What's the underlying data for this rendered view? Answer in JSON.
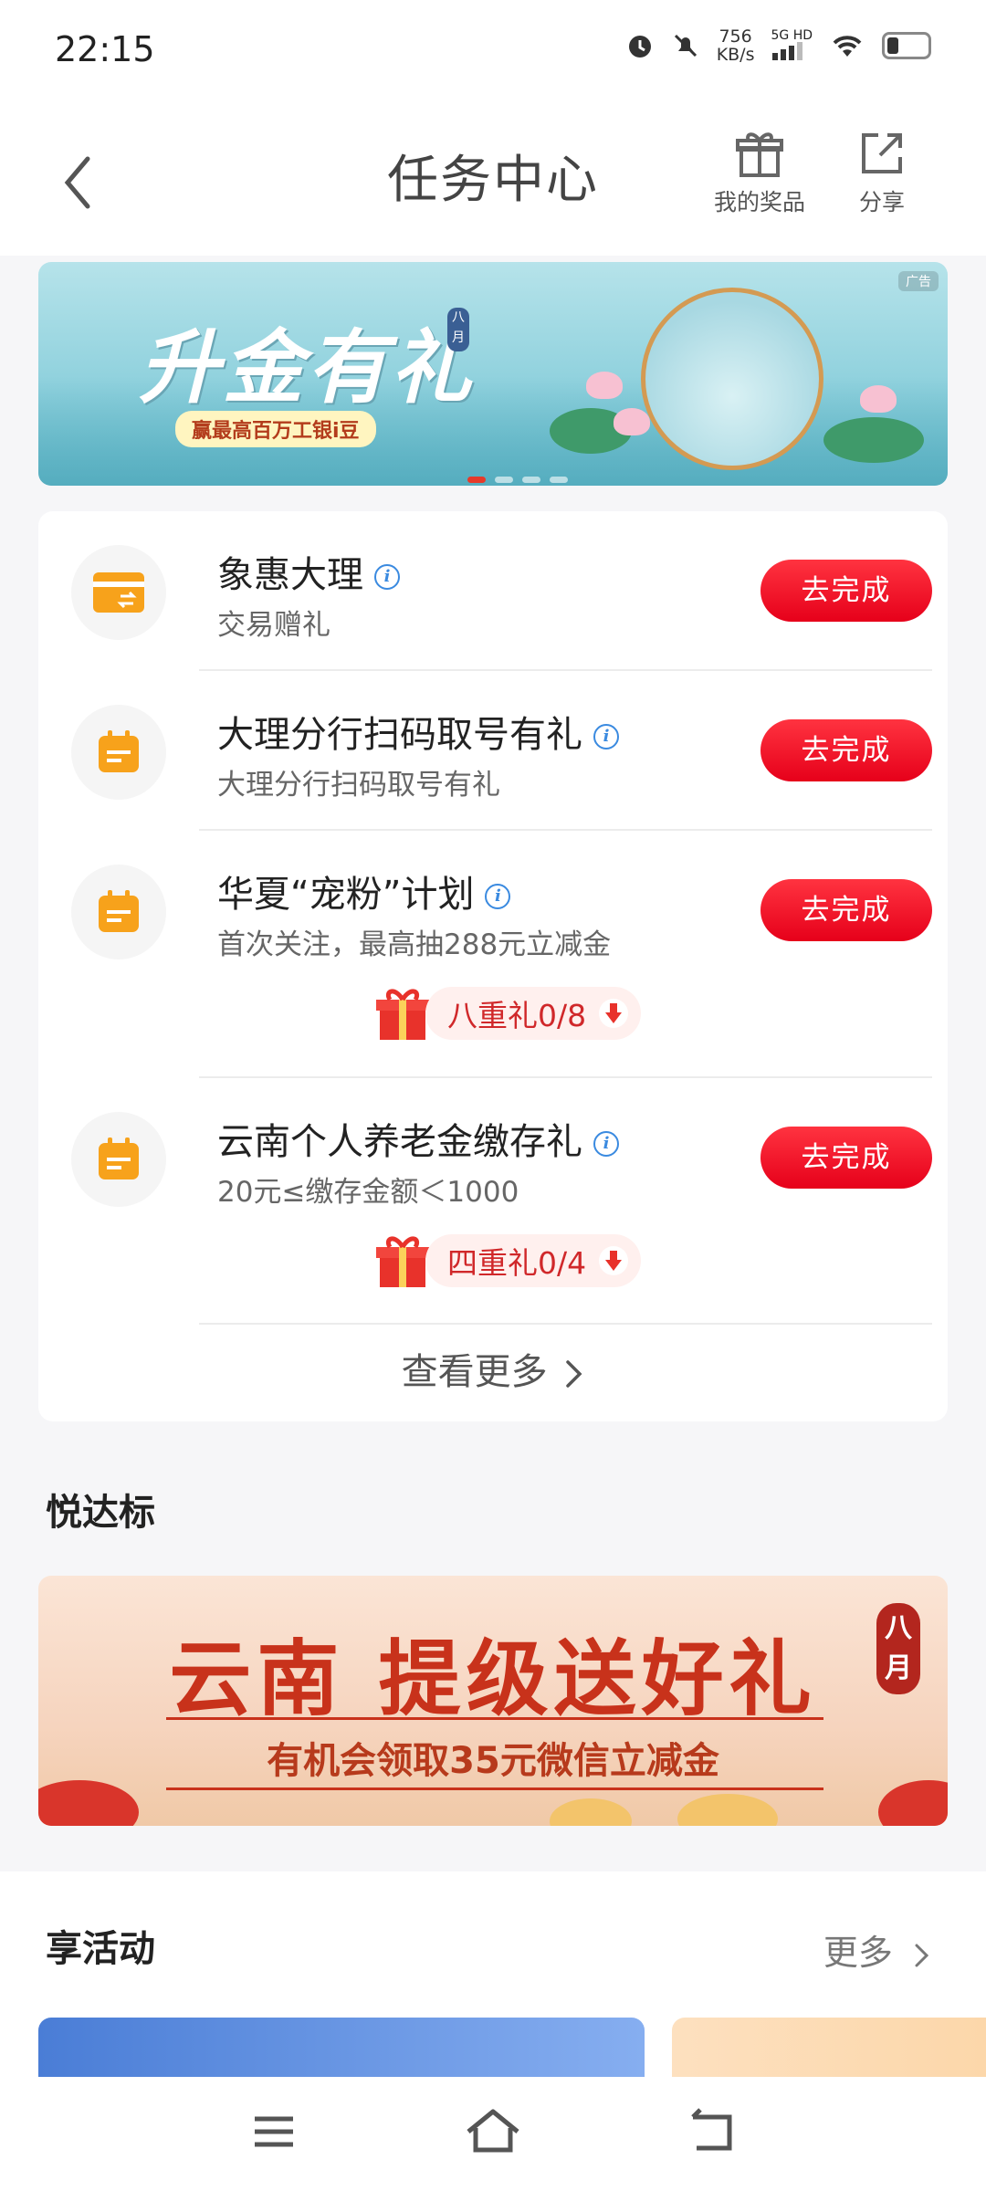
{
  "status_bar": {
    "time": "22:15",
    "net_speed_value": "756",
    "net_speed_unit": "KB/s",
    "signal_label": "5G HD"
  },
  "header": {
    "title": "任务中心",
    "prizes_label": "我的奖品",
    "share_label": "分享"
  },
  "top_banner": {
    "title": "升金有礼",
    "subtitle": "赢最高百万工银i豆",
    "tag": "八月",
    "ad_label": "广告",
    "page_count": 4,
    "active_page": 1
  },
  "tasks": [
    {
      "name": "象惠大理",
      "desc": "交易赠礼",
      "button": "去完成",
      "icon": "card-transfer-icon"
    },
    {
      "name": "大理分行扫码取号有礼",
      "desc": "大理分行扫码取号有礼",
      "button": "去完成",
      "icon": "calendar-icon"
    },
    {
      "name": "华夏“宠粉”计划",
      "desc": "首次关注，最高抽288元立减金",
      "button": "去完成",
      "icon": "calendar-icon",
      "gift": "八重礼0/8"
    },
    {
      "name": "云南个人养老金缴存礼",
      "desc": "20元≤缴存金额＜1000",
      "button": "去完成",
      "icon": "calendar-icon",
      "gift": "四重礼0/4"
    }
  ],
  "view_more": "查看更多",
  "section_yueda": {
    "title": "悦达标"
  },
  "promo_banner": {
    "title": "云南 提级送好礼",
    "subtitle": "有机会领取35元微信立减金",
    "month": "八月"
  },
  "section_activities": {
    "title": "享活动",
    "more": "更多"
  },
  "colors": {
    "accent_red": "#e6001a",
    "icon_orange": "#f7a21b",
    "info_blue": "#3a8ae0"
  }
}
